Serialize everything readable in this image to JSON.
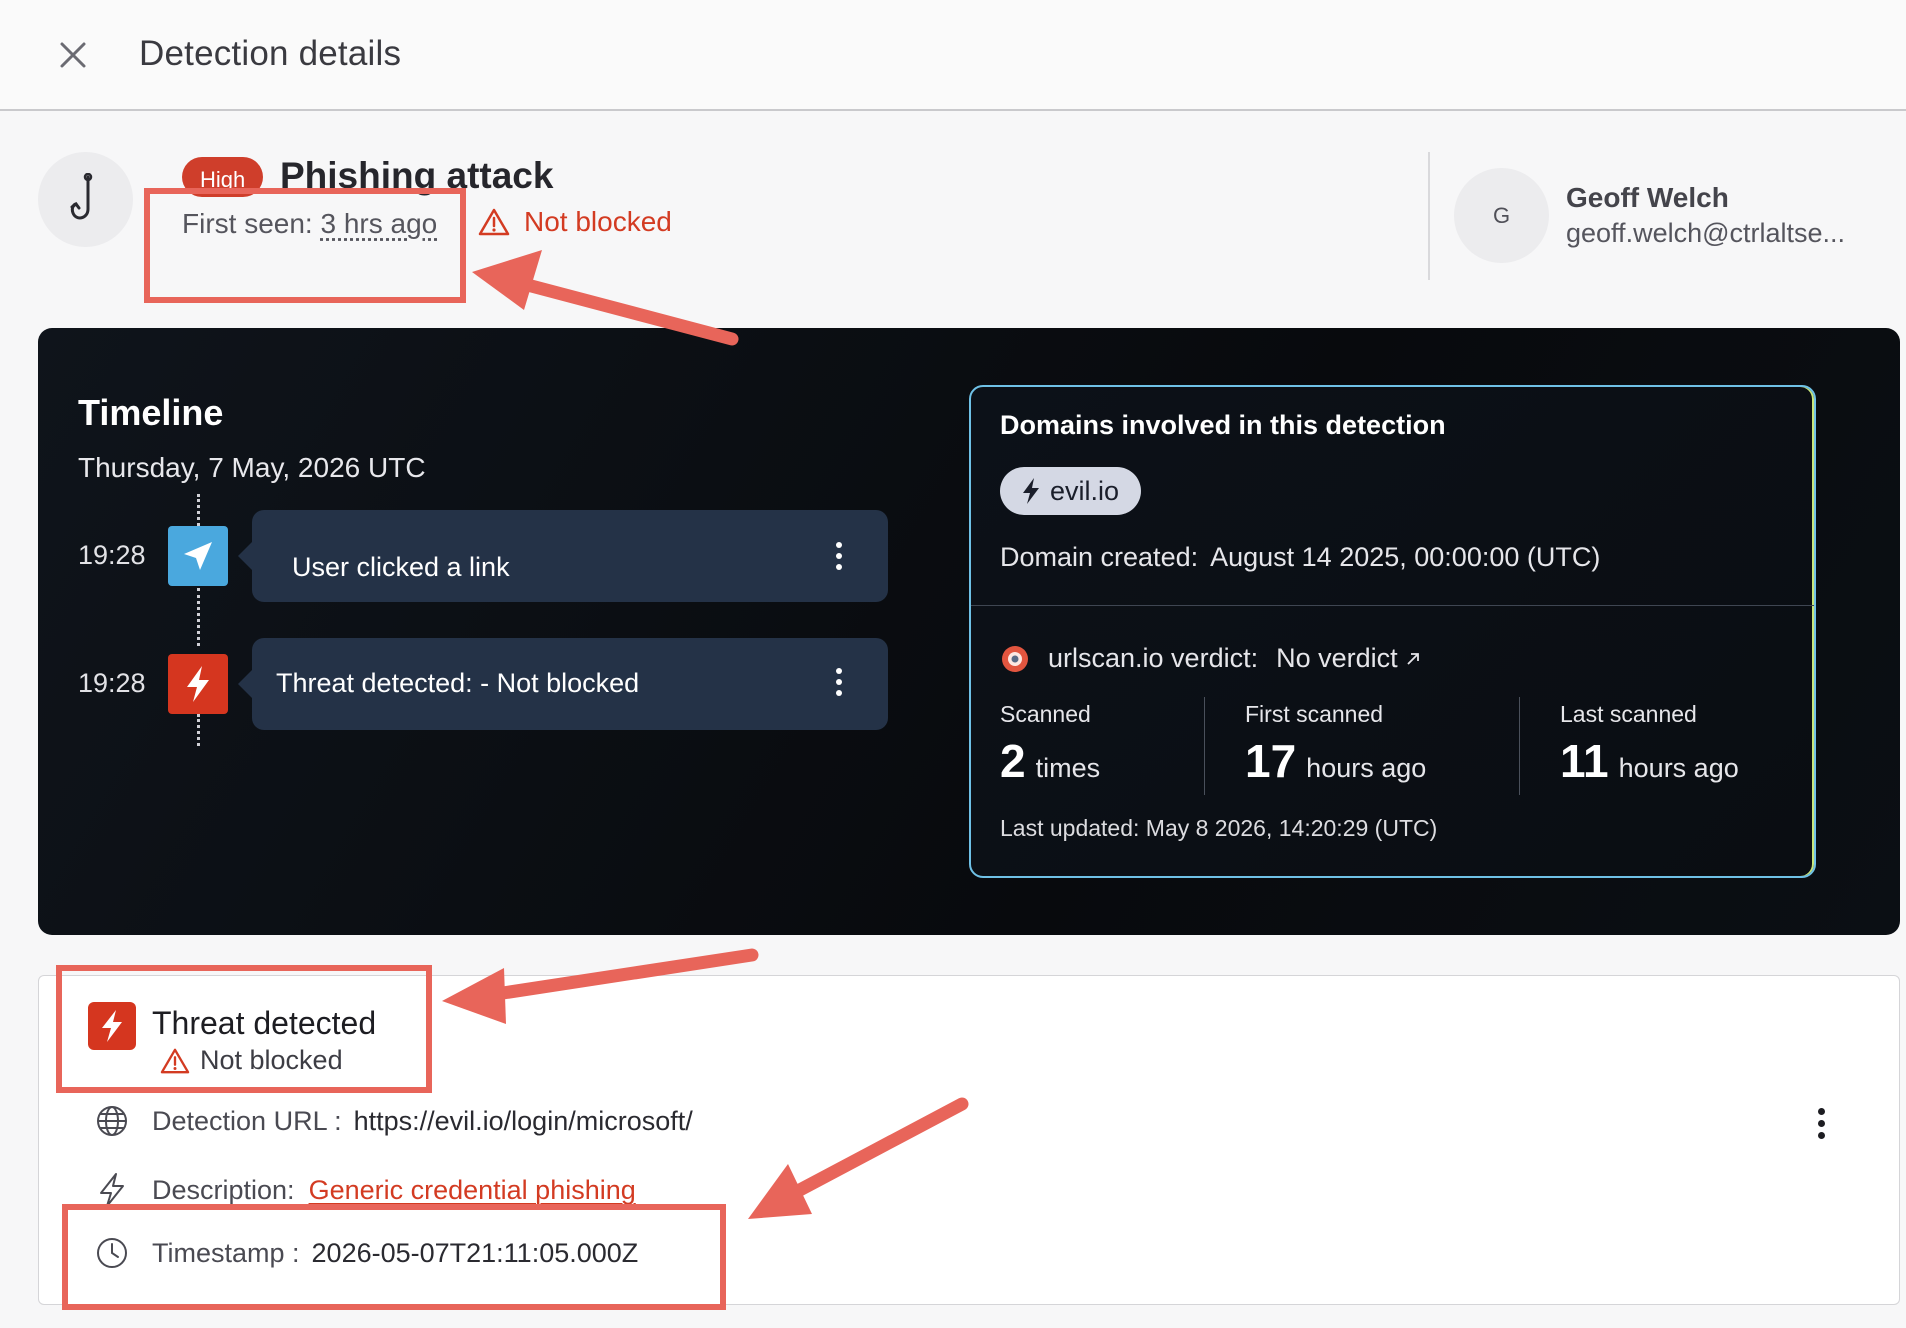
{
  "header": {
    "title": "Detection details"
  },
  "summary": {
    "severity": "High",
    "title": "Phishing attack",
    "first_seen_label": "First seen:",
    "first_seen_value": "3 hrs ago",
    "status": "Not blocked"
  },
  "user": {
    "initial": "G",
    "name": "Geoff Welch",
    "email": "geoff.welch@ctrlaltse..."
  },
  "timeline": {
    "title": "Timeline",
    "date": "Thursday, 7 May, 2026 UTC",
    "events": [
      {
        "time": "19:28",
        "label": "User clicked a link",
        "icon": "send-icon"
      },
      {
        "time": "19:28",
        "label": "Threat detected:  - Not blocked",
        "icon": "lightning-icon"
      }
    ]
  },
  "domains": {
    "title": "Domains involved in this detection",
    "domain": "evil.io",
    "created_label": "Domain created:",
    "created_value": "August 14 2025, 00:00:00 (UTC)",
    "verdict_label": "urlscan.io verdict:",
    "verdict_value": "No verdict",
    "stats": [
      {
        "label": "Scanned",
        "value": "2",
        "unit": "times"
      },
      {
        "label": "First scanned",
        "value": "17",
        "unit": "hours ago"
      },
      {
        "label": "Last scanned",
        "value": "11",
        "unit": "hours ago"
      }
    ],
    "last_updated": "Last updated: May 8 2026, 14:20:29 (UTC)"
  },
  "threat": {
    "title": "Threat detected",
    "status": "Not blocked",
    "url_label": "Detection URL :",
    "url_value": "https://evil.io/login/microsoft/",
    "description_label": "Description:",
    "description_value": "Generic credential phishing",
    "timestamp_label": "Timestamp :",
    "timestamp_value": "2026-05-07T21:11:05.000Z"
  },
  "colors": {
    "accent_red": "#d33b22",
    "annotation": "#e8655a",
    "panel_dark": "#0b0f14",
    "card_navy": "#243247"
  }
}
